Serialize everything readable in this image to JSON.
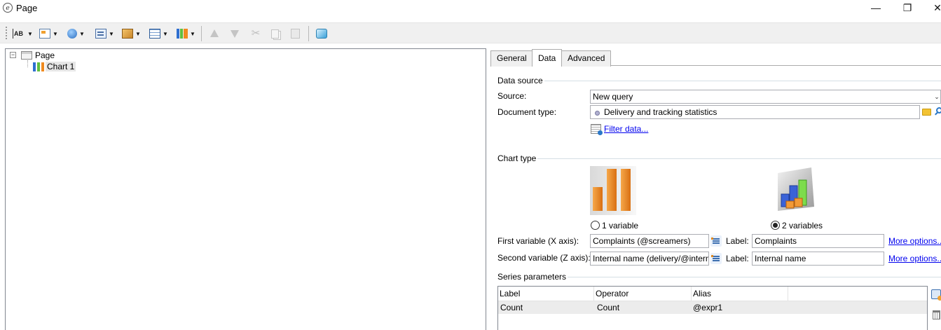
{
  "window": {
    "title": "Page",
    "minimize": "—",
    "restore": "❐",
    "close": "✕"
  },
  "toolbar": {
    "buttons": [
      {
        "icon": "text-field-icon",
        "label": "AB"
      },
      {
        "icon": "insert-element-icon"
      },
      {
        "icon": "globe-icon"
      },
      {
        "icon": "form-icon"
      },
      {
        "icon": "cube-icon"
      },
      {
        "icon": "table-icon"
      },
      {
        "icon": "chart-icon"
      },
      {
        "icon": "move-up-icon"
      },
      {
        "icon": "move-down-icon"
      },
      {
        "icon": "cut-icon"
      },
      {
        "icon": "copy-icon"
      },
      {
        "icon": "paste-icon"
      },
      {
        "icon": "refresh-icon"
      }
    ],
    "cut_glyph": "✂"
  },
  "tree": {
    "root_label": "Page",
    "expander_glyph": "−",
    "child_label": "Chart 1"
  },
  "tabs": [
    {
      "label": "General"
    },
    {
      "label": "Data"
    },
    {
      "label": "Advanced"
    }
  ],
  "data_source": {
    "section_title": "Data source",
    "source_label": "Source:",
    "source_value": "New query",
    "doc_type_label": "Document type:",
    "doc_type_value": "Delivery and tracking statistics",
    "filter_link": "Filter data..."
  },
  "chart_type": {
    "section_title": "Chart type",
    "option1_label": "1 variable",
    "option2_label": "2 variables",
    "selected": "2 variables"
  },
  "variables": {
    "first_label": "First variable (X axis):",
    "first_value": "Complaints (@screamers)",
    "first_label_label": "Label:",
    "first_label_value": "Complaints",
    "first_more": "More options...",
    "second_label": "Second variable (Z axis):",
    "second_value": "Internal name (delivery/@internalName)",
    "second_label_label": "Label:",
    "second_label_value": "Internal name",
    "second_more": "More options..."
  },
  "series": {
    "section_title": "Series parameters",
    "columns": [
      "Label",
      "Operator",
      "Alias"
    ],
    "rows": [
      {
        "label": "Count",
        "operator": "Count",
        "alias": "@expr1"
      }
    ]
  }
}
